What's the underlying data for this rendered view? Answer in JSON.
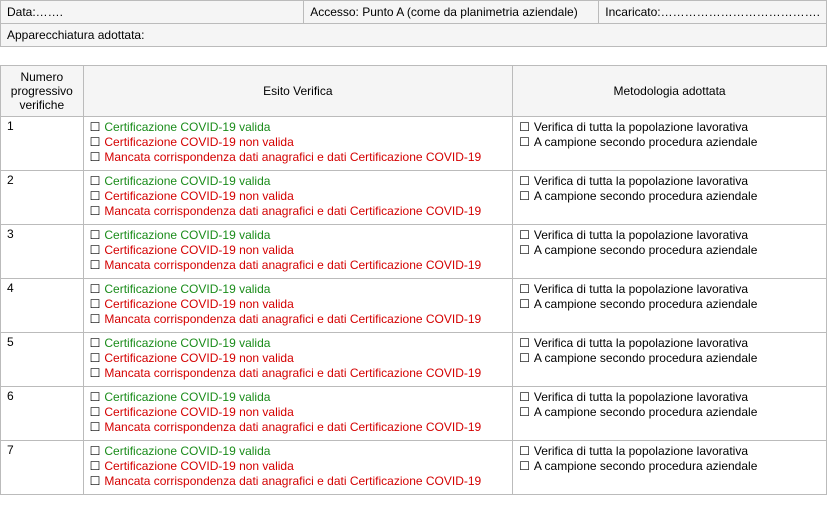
{
  "header": {
    "data_label": "Data:…….",
    "accesso_label": "Accesso: Punto A (come da planimetria aziendale)",
    "incaricato_label": "Incaricato:………………………………….",
    "apparecchiatura_label": "Apparecchiatura adottata:"
  },
  "columns": {
    "num": "Numero progressivo verifiche",
    "esito": "Esito Verifica",
    "metodologia": "Metodologia adottata"
  },
  "checkbox": "☐",
  "esito_options": {
    "opt1": "Certificazione COVID-19 valida",
    "opt2": "Certificazione COVID-19 non valida",
    "opt3": "Mancata corrispondenza dati anagrafici e dati Certificazione COVID-19"
  },
  "metodologia_options": {
    "opt1": "Verifica di tutta la popolazione lavorativa",
    "opt2": "A campione secondo procedura aziendale"
  },
  "rows": [
    {
      "num": "1"
    },
    {
      "num": "2"
    },
    {
      "num": "3"
    },
    {
      "num": "4"
    },
    {
      "num": "5"
    },
    {
      "num": "6"
    },
    {
      "num": "7"
    }
  ]
}
